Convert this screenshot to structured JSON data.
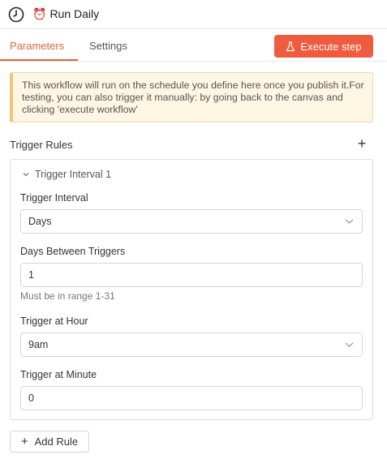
{
  "header": {
    "title": "Run Daily",
    "alarm_glyph": "⏰"
  },
  "tabs": [
    {
      "label": "Parameters"
    },
    {
      "label": "Settings"
    }
  ],
  "toolbar": {
    "execute_label": "Execute step"
  },
  "notice": {
    "text": "This workflow will run on the schedule you define here once you publish it.For testing, you can also trigger it manually: by going back to the canvas and clicking 'execute workflow'"
  },
  "rules": {
    "title": "Trigger Rules",
    "add_label": "Add Rule",
    "items": [
      {
        "header": "Trigger Interval 1",
        "interval": {
          "label": "Trigger Interval",
          "value": "Days"
        },
        "between": {
          "label": "Days Between Triggers",
          "value": "1",
          "hint": "Must be in range 1-31"
        },
        "hour": {
          "label": "Trigger at Hour",
          "value": "9am"
        },
        "minute": {
          "label": "Trigger at Minute",
          "value": "0"
        }
      }
    ]
  },
  "colors": {
    "accent": "#ee5b3e",
    "tab_active": "#e4633c",
    "notice_bg": "#fdf6e3",
    "notice_border": "#f0c674"
  }
}
